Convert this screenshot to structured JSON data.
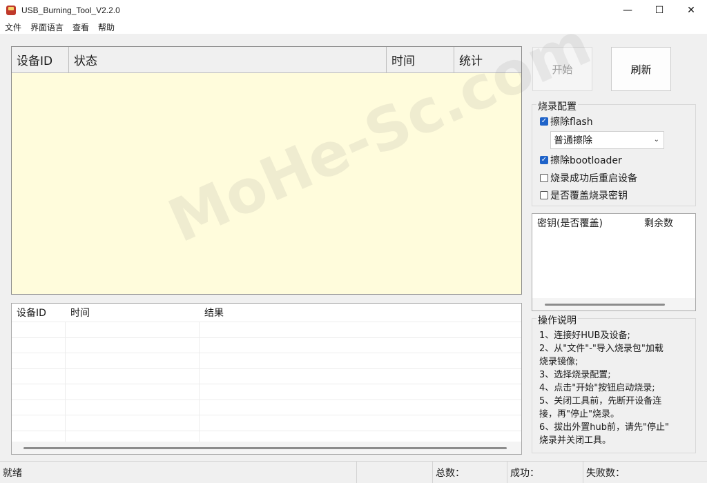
{
  "window": {
    "title": "USB_Burning_Tool_V2.2.0",
    "minimize_glyph": "—",
    "maximize_glyph": "☐",
    "close_glyph": "✕"
  },
  "menu": [
    {
      "label": "文件"
    },
    {
      "label": "界面语言"
    },
    {
      "label": "查看"
    },
    {
      "label": "帮助"
    }
  ],
  "main_table": {
    "columns": [
      "设备ID",
      "状态",
      "时间",
      "统计"
    ]
  },
  "result_table": {
    "columns": [
      "设备ID",
      "时间",
      "结果"
    ]
  },
  "buttons": {
    "start": "开始",
    "refresh": "刷新"
  },
  "burn_config": {
    "title": "烧录配置",
    "erase_flash": {
      "label": "擦除flash",
      "checked": true
    },
    "erase_mode": {
      "selected": "普通擦除"
    },
    "erase_bootloader": {
      "label": "擦除bootloader",
      "checked": true
    },
    "reboot_after": {
      "label": "烧录成功后重启设备",
      "checked": false
    },
    "overwrite_key": {
      "label": "是否覆盖烧录密钥",
      "checked": false
    }
  },
  "keys_table": {
    "columns": [
      "密钥(是否覆盖)",
      "剩余数"
    ]
  },
  "instructions": {
    "title": "操作说明",
    "lines": [
      "1、连接好HUB及设备;",
      "2、从\"文件\"-\"导入烧录包\"加载",
      "烧录镜像;",
      "3、选择烧录配置;",
      "4、点击\"开始\"按钮启动烧录;",
      "5、关闭工具前，先断开设备连",
      "接，再\"停止\"烧录。",
      "6、拔出外置hub前，请先\"停止\"",
      "烧录并关闭工具。"
    ]
  },
  "watermark": "MoHe-Sc.com",
  "status_bar": {
    "status": "就绪",
    "total_label": "总数：",
    "success_label": "成功：",
    "fail_label": "失败数："
  },
  "colors": {
    "main_table_bg": "#fffcdc",
    "checkbox_checked": "#1f63c9",
    "app_icon": "#c0392b"
  }
}
